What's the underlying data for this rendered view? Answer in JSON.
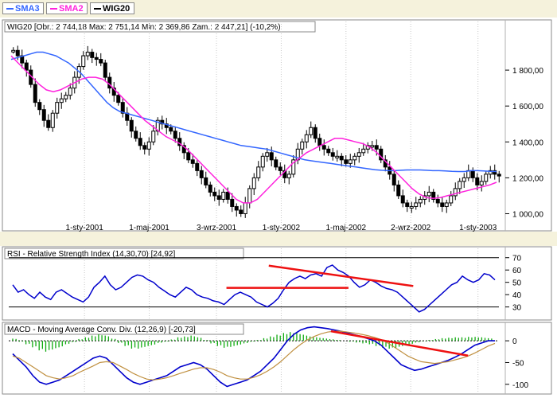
{
  "legend_tabs": [
    {
      "label": "SMA3",
      "color": "#3366ff"
    },
    {
      "label": "SMA2",
      "color": "#ff22dd"
    },
    {
      "label": "WIG20",
      "color": "#000000"
    }
  ],
  "chart_data": [
    {
      "type": "candlestick",
      "title": "WIG20 [Obr.: 2 744,18  Max: 2 751,14  Min: 2 369,86  Zam.: 2 447,21] (-10,2%)",
      "x_tick_labels": [
        "1-sty-2001",
        "1-maj-2001",
        "3-wrz-2001",
        "1-sty-2002",
        "1-maj-2002",
        "2-wrz-2002",
        "1-sty-2003"
      ],
      "y_tick_labels": [
        "1 000,00",
        "1 200,00",
        "1 400,00",
        "1 600,00",
        "1 800,00"
      ],
      "y_ticks": [
        1000,
        1200,
        1400,
        1600,
        1800
      ],
      "ylim": [
        940,
        2000
      ],
      "price_close": [
        1910,
        1880,
        1840,
        1800,
        1720,
        1620,
        1580,
        1520,
        1480,
        1560,
        1620,
        1640,
        1660,
        1700,
        1760,
        1820,
        1880,
        1900,
        1870,
        1860,
        1840,
        1760,
        1700,
        1660,
        1620,
        1560,
        1520,
        1460,
        1420,
        1380,
        1360,
        1400,
        1460,
        1520,
        1500,
        1480,
        1460,
        1420,
        1380,
        1340,
        1300,
        1280,
        1240,
        1200,
        1160,
        1120,
        1100,
        1080,
        1120,
        1080,
        1040,
        1020,
        1000,
        1060,
        1140,
        1200,
        1260,
        1320,
        1340,
        1300,
        1260,
        1240,
        1200,
        1220,
        1300,
        1360,
        1400,
        1440,
        1480,
        1420,
        1380,
        1360,
        1340,
        1320,
        1320,
        1300,
        1280,
        1300,
        1320,
        1340,
        1360,
        1380,
        1380,
        1360,
        1300,
        1260,
        1220,
        1160,
        1100,
        1060,
        1040,
        1040,
        1060,
        1080,
        1100,
        1120,
        1080,
        1060,
        1040,
        1060,
        1100,
        1140,
        1180,
        1200,
        1240,
        1200,
        1160,
        1180,
        1220,
        1240,
        1220,
        1210
      ],
      "series": [
        {
          "name": "SMA3",
          "color": "#3366ff",
          "values": [
            1860,
            1870,
            1880,
            1890,
            1900,
            1900,
            1890,
            1880,
            1860,
            1840,
            1810,
            1780,
            1740,
            1700,
            1660,
            1620,
            1590,
            1570,
            1560,
            1550,
            1540,
            1530,
            1520,
            1510,
            1500,
            1490,
            1480,
            1470,
            1460,
            1450,
            1440,
            1430,
            1420,
            1410,
            1400,
            1390,
            1380,
            1375,
            1370,
            1365,
            1360,
            1350,
            1340,
            1330,
            1320,
            1310,
            1300,
            1295,
            1290,
            1285,
            1280,
            1275,
            1270,
            1265,
            1260,
            1255,
            1250,
            1245,
            1242,
            1240,
            1240,
            1242,
            1244,
            1244,
            1244,
            1242,
            1240,
            1240,
            1238,
            1236,
            1235,
            1235,
            1240,
            1240,
            1238,
            1236,
            1235
          ]
        },
        {
          "name": "SMA2",
          "color": "#ff22dd",
          "values": [
            1880,
            1840,
            1800,
            1760,
            1720,
            1690,
            1680,
            1690,
            1710,
            1730,
            1750,
            1760,
            1760,
            1750,
            1720,
            1680,
            1640,
            1600,
            1560,
            1520,
            1490,
            1460,
            1430,
            1410,
            1390,
            1360,
            1320,
            1280,
            1240,
            1200,
            1160,
            1120,
            1080,
            1060,
            1060,
            1080,
            1120,
            1160,
            1200,
            1240,
            1280,
            1310,
            1340,
            1360,
            1380,
            1400,
            1420,
            1420,
            1410,
            1400,
            1390,
            1370,
            1340,
            1300,
            1260,
            1220,
            1180,
            1140,
            1110,
            1090,
            1085,
            1090,
            1100,
            1110,
            1120,
            1130,
            1140,
            1150,
            1160,
            1175
          ]
        }
      ]
    },
    {
      "type": "line",
      "title": "RSI - Relative Strength Index (14,30,70) [24,92]",
      "y_tick_labels": [
        "30",
        "40",
        "50",
        "60",
        "70"
      ],
      "y_ticks": [
        30,
        40,
        50,
        60,
        70
      ],
      "ylim": [
        22,
        75
      ],
      "reference_levels": [
        30,
        70
      ],
      "series": [
        {
          "name": "RSI",
          "color": "#0000cc",
          "values": [
            48,
            42,
            44,
            40,
            37,
            42,
            38,
            36,
            42,
            44,
            41,
            38,
            36,
            34,
            38,
            46,
            50,
            55,
            48,
            44,
            46,
            50,
            54,
            56,
            55,
            52,
            50,
            46,
            43,
            40,
            38,
            42,
            46,
            44,
            40,
            38,
            37,
            35,
            34,
            32,
            36,
            40,
            42,
            40,
            38,
            34,
            32,
            30,
            33,
            37,
            44,
            50,
            53,
            55,
            53,
            56,
            57,
            55,
            62,
            64,
            60,
            58,
            55,
            50,
            46,
            48,
            52,
            50,
            47,
            45,
            44,
            42,
            38,
            34,
            30,
            26,
            28,
            32,
            36,
            40,
            44,
            48,
            50,
            55,
            52,
            50,
            52,
            57,
            56,
            52
          ]
        }
      ],
      "trendlines": [
        {
          "from": [
            0.445,
            45.5
          ],
          "to": [
            0.69,
            45.5
          ],
          "color": "#ee1111"
        },
        {
          "from": [
            0.53,
            63.5
          ],
          "to": [
            0.82,
            47
          ],
          "color": "#ee1111"
        }
      ]
    },
    {
      "type": "line",
      "title": "MACD - Moving Average Conv. Div. (12,26,9) [-20,73]",
      "y_tick_labels": [
        "0",
        "-50",
        "-100"
      ],
      "y_ticks": [
        0,
        -50,
        -100
      ],
      "ylim": [
        -115,
        35
      ],
      "series": [
        {
          "name": "MACD",
          "color": "#0000cc",
          "values": [
            -30,
            -45,
            -60,
            -80,
            -95,
            -100,
            -95,
            -90,
            -80,
            -70,
            -60,
            -50,
            -40,
            -35,
            -40,
            -55,
            -70,
            -85,
            -95,
            -100,
            -95,
            -90,
            -85,
            -80,
            -70,
            -60,
            -55,
            -50,
            -55,
            -65,
            -80,
            -95,
            -105,
            -100,
            -95,
            -90,
            -80,
            -70,
            -55,
            -40,
            -20,
            0,
            15,
            25,
            30,
            32,
            30,
            28,
            25,
            22,
            18,
            14,
            10,
            5,
            0,
            -10,
            -25,
            -40,
            -55,
            -62,
            -68,
            -65,
            -60,
            -55,
            -50,
            -45,
            -38,
            -30,
            -20,
            -10,
            -5,
            0,
            0
          ]
        },
        {
          "name": "Signal",
          "color": "#c09040",
          "values": [
            -35,
            -40,
            -50,
            -60,
            -70,
            -80,
            -85,
            -88,
            -85,
            -80,
            -72,
            -65,
            -58,
            -50,
            -48,
            -50,
            -58,
            -66,
            -75,
            -82,
            -88,
            -90,
            -88,
            -85,
            -80,
            -75,
            -70,
            -65,
            -62,
            -62,
            -66,
            -72,
            -80,
            -85,
            -88,
            -88,
            -84,
            -78,
            -70,
            -60,
            -48,
            -34,
            -20,
            -8,
            2,
            10,
            16,
            20,
            22,
            22,
            20,
            18,
            15,
            12,
            8,
            3,
            -5,
            -15,
            -25,
            -35,
            -42,
            -48,
            -50,
            -52,
            -50,
            -48,
            -44,
            -40,
            -35,
            -28,
            -20,
            -12,
            -6
          ]
        }
      ],
      "histogram": [
        5,
        -2,
        -8,
        -15,
        -22,
        -25,
        -20,
        -15,
        -8,
        -3,
        4,
        8,
        12,
        15,
        12,
        5,
        -5,
        -12,
        -18,
        -18,
        -14,
        -10,
        -5,
        -2,
        3,
        8,
        10,
        12,
        8,
        2,
        -6,
        -12,
        -16,
        -14,
        -10,
        -6,
        -2,
        2,
        6,
        10,
        14,
        18,
        20,
        18,
        14,
        10,
        8,
        6,
        4,
        2,
        0,
        -2,
        -4,
        -6,
        -8,
        -12,
        -16,
        -18,
        -16,
        -12,
        -8,
        -4,
        -1,
        2,
        4,
        6,
        7,
        8,
        8,
        9,
        9,
        8,
        6
      ],
      "trendlines": [
        {
          "from": [
            0.655,
            22
          ],
          "to": [
            0.93,
            -34
          ],
          "color": "#ee1111"
        }
      ]
    }
  ]
}
